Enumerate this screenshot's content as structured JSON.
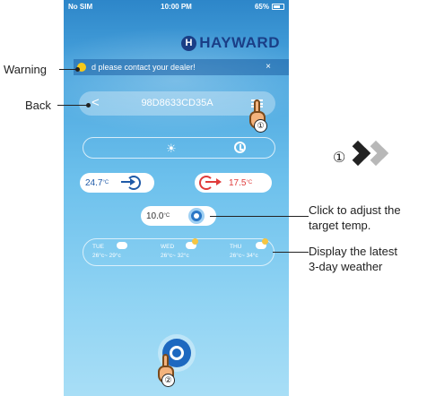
{
  "status_bar": {
    "carrier": "No SIM",
    "time": "10:00 PM",
    "battery": "65%"
  },
  "brand": {
    "name": "HAYWARD",
    "mark": "H"
  },
  "warning": {
    "message": "d please contact your dealer!",
    "close": "×"
  },
  "device": {
    "back": "<",
    "id": "98D8633CD35A"
  },
  "temps": {
    "inlet": "24.7",
    "inlet_unit": "°C",
    "outlet": "17.5",
    "outlet_unit": "°C",
    "target": "10.0",
    "target_unit": "°C"
  },
  "weather": [
    {
      "day": "TUE",
      "range": "26°c~ 29°c"
    },
    {
      "day": "WED",
      "range": "26°c~ 32°c"
    },
    {
      "day": "THU",
      "range": "26°c~ 34°c"
    }
  ],
  "annotations": {
    "warning": "Warning",
    "back": "Back",
    "adjust_line1": "Click to adjust the",
    "adjust_line2": "target temp.",
    "weather_line1": "Display the latest",
    "weather_line2": "3-day weather",
    "step1": "①",
    "step2": "②"
  },
  "colors": {
    "inlet": "#1f5aa8",
    "outlet": "#e03b3b",
    "warning_dot": "#f6c91a",
    "brand": "#1a3e86",
    "settings": "#1d68c0"
  }
}
